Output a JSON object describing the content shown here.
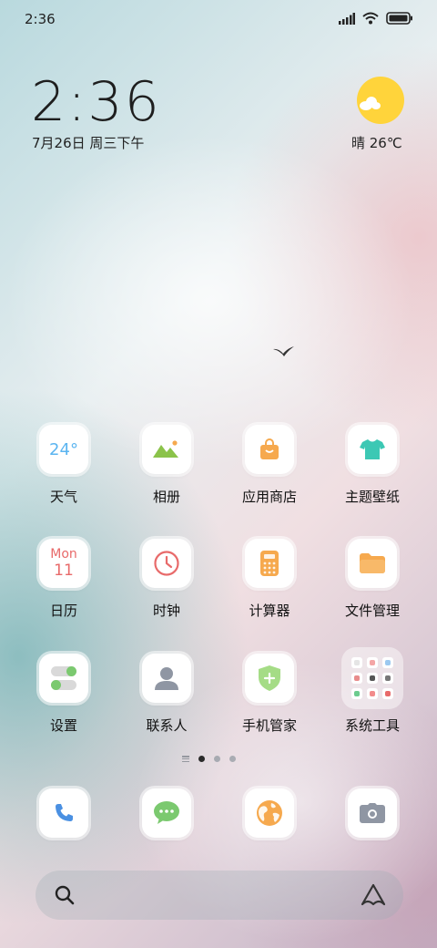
{
  "status_bar": {
    "time": "2:36",
    "icons": [
      "signal-icon",
      "wifi-icon",
      "battery-icon"
    ]
  },
  "lock_widget": {
    "clock": "2:36",
    "date": "7月26日 周三下午",
    "weather": "晴 26℃",
    "weather_icon": "sun-cloud-icon"
  },
  "apps": [
    {
      "label": "天气",
      "icon": "weather-icon",
      "tile_text": "24°"
    },
    {
      "label": "相册",
      "icon": "gallery-icon"
    },
    {
      "label": "应用商店",
      "icon": "app-store-icon"
    },
    {
      "label": "主题壁纸",
      "icon": "themes-icon"
    },
    {
      "label": "日历",
      "icon": "calendar-icon",
      "tile_month": "Mon",
      "tile_day": "11"
    },
    {
      "label": "时钟",
      "icon": "clock-icon"
    },
    {
      "label": "计算器",
      "icon": "calculator-icon"
    },
    {
      "label": "文件管理",
      "icon": "file-manager-icon"
    },
    {
      "label": "设置",
      "icon": "settings-icon"
    },
    {
      "label": "联系人",
      "icon": "contacts-icon"
    },
    {
      "label": "手机管家",
      "icon": "security-icon"
    },
    {
      "label": "系统工具",
      "icon": "folder-icon"
    }
  ],
  "page_indicator": {
    "pages": 3,
    "active": 0
  },
  "dock": [
    {
      "icon": "phone-icon"
    },
    {
      "icon": "messages-icon"
    },
    {
      "icon": "browser-icon"
    },
    {
      "icon": "camera-icon"
    }
  ],
  "search_bar": {
    "left_icon": "search-icon",
    "right_icon": "assistant-icon"
  },
  "colors": {
    "accent_orange": "#F6A94E",
    "accent_green": "#7BC96F",
    "accent_blue": "#4A90E2",
    "accent_red": "#E86A6A",
    "weather_yellow": "#FFD43B"
  }
}
